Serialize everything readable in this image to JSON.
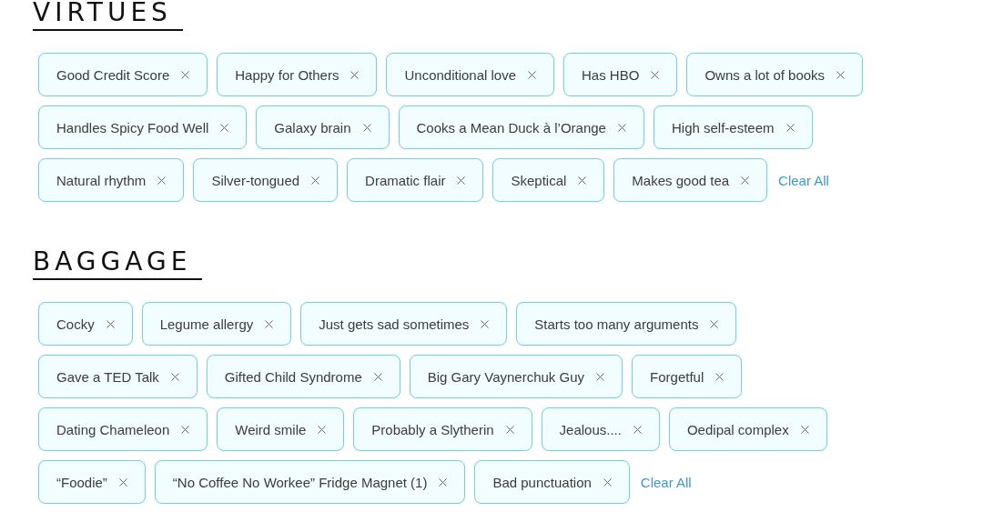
{
  "sections": [
    {
      "heading": "VIRTUES",
      "rows": [
        {
          "tags": [
            "Good Credit Score",
            "Happy for Others",
            "Unconditional love",
            "Has HBO",
            "Owns a lot of books"
          ]
        },
        {
          "tags": [
            "Handles Spicy Food Well",
            "Galaxy brain",
            "Cooks a Mean Duck à l’Orange",
            "High self-esteem"
          ]
        },
        {
          "tags": [
            "Natural rhythm",
            "Silver-tongued",
            "Dramatic flair",
            "Skeptical",
            "Makes good tea"
          ]
        }
      ],
      "clear_all": "Clear All"
    },
    {
      "heading": "BAGGAGE",
      "rows": [
        {
          "tags": [
            "Cocky",
            "Legume allergy",
            "Just gets sad sometimes",
            "Starts too many arguments"
          ]
        },
        {
          "tags": [
            "Gave a TED Talk",
            "Gifted Child Syndrome",
            "Big Gary Vaynerchuk Guy",
            "Forgetful"
          ]
        },
        {
          "tags": [
            "Dating Chameleon",
            "Weird smile",
            "Probably a Slytherin",
            "Jealous....",
            "Oedipal complex"
          ]
        },
        {
          "tags": [
            "“Foodie”",
            "“No Coffee No Workee” Fridge Magnet (1)",
            "Bad punctuation"
          ]
        }
      ],
      "clear_all": "Clear All"
    }
  ]
}
